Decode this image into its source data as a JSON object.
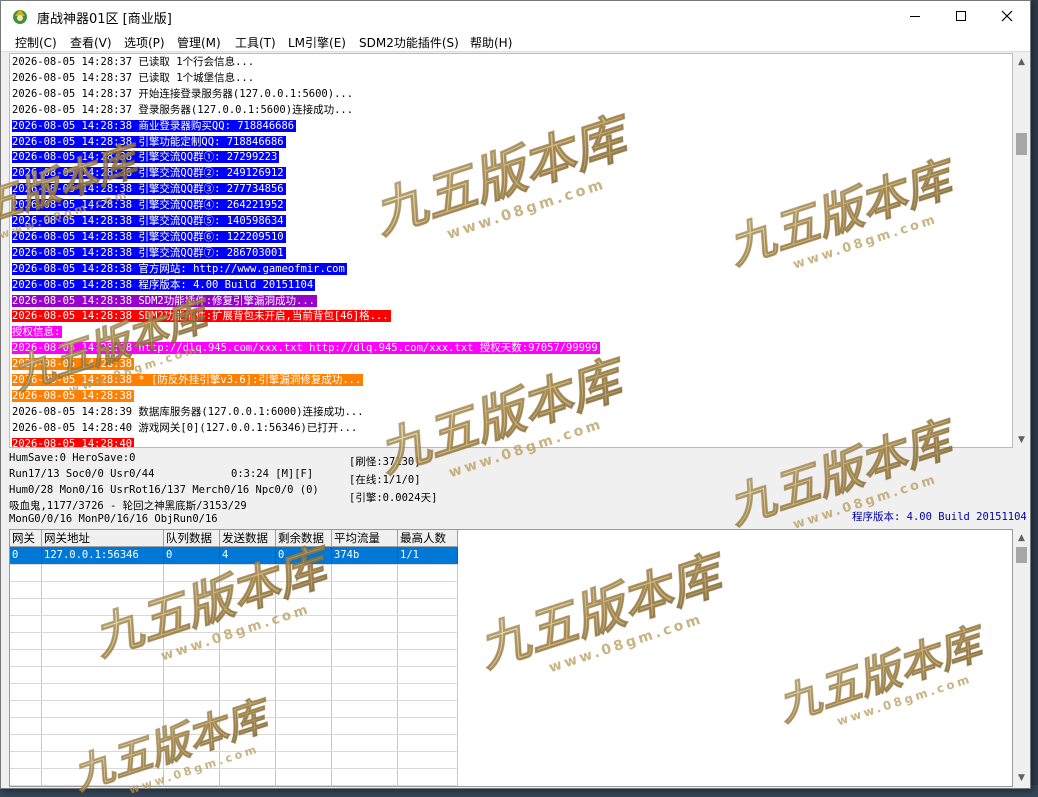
{
  "window": {
    "title": "唐战神器01区 [商业版]"
  },
  "menu": [
    "控制(C)",
    "查看(V)",
    "选项(P)",
    "管理(M)",
    "工具(T)",
    "LM引擎(E)",
    "SDM2功能插件(S)",
    "帮助(H)"
  ],
  "log": [
    {
      "text": "2026-08-05 14:28:37 已读取 1个行会信息...",
      "bg": "",
      "fg": "#000000"
    },
    {
      "text": "2026-08-05 14:28:37 已读取 1个城堡信息...",
      "bg": "",
      "fg": "#000000"
    },
    {
      "text": "2026-08-05 14:28:37 开始连接登录服务器(127.0.0.1:5600)...",
      "bg": "",
      "fg": "#000000"
    },
    {
      "text": "2026-08-05 14:28:37 登录服务器(127.0.0.1:5600)连接成功...",
      "bg": "",
      "fg": "#000000"
    },
    {
      "text": "2026-08-05 14:28:38 商业登录器购买QQ: 718846686",
      "bg": "#0000ff",
      "fg": "#ffffff"
    },
    {
      "text": "2026-08-05 14:28:38 引擎功能定制QQ: 718846686",
      "bg": "#0000ff",
      "fg": "#ffffff"
    },
    {
      "text": "2026-08-05 14:28:38 引擎交流QQ群①: 27299223",
      "bg": "#0000ff",
      "fg": "#ffffff"
    },
    {
      "text": "2026-08-05 14:28:38 引擎交流QQ群②: 249126912",
      "bg": "#0000ff",
      "fg": "#ffffff"
    },
    {
      "text": "2026-08-05 14:28:38 引擎交流QQ群③: 277734856",
      "bg": "#0000ff",
      "fg": "#ffffff"
    },
    {
      "text": "2026-08-05 14:28:38 引擎交流QQ群④: 264221952",
      "bg": "#0000ff",
      "fg": "#ffffff"
    },
    {
      "text": "2026-08-05 14:28:38 引擎交流QQ群⑤: 140598634",
      "bg": "#0000ff",
      "fg": "#ffffff"
    },
    {
      "text": "2026-08-05 14:28:38 引擎交流QQ群⑥: 122209510",
      "bg": "#0000ff",
      "fg": "#ffffff"
    },
    {
      "text": "2026-08-05 14:28:38 引擎交流QQ群⑦: 286703001",
      "bg": "#0000ff",
      "fg": "#ffffff"
    },
    {
      "text": "2026-08-05 14:28:38 官方网站: http://www.gameofmir.com",
      "bg": "#0000ff",
      "fg": "#ffffff"
    },
    {
      "text": "2026-08-05 14:28:38 程序版本: 4.00 Build 20151104",
      "bg": "#0000ff",
      "fg": "#ffffff"
    },
    {
      "text": "2026-08-05 14:28:38 SDM2功能插件:修复引擎漏洞成功...",
      "bg": "#9900cc",
      "fg": "#ffffff"
    },
    {
      "text": "2026-08-05 14:28:38 SDM2功能插件:扩展背包未开启,当前背包[46]格...",
      "bg": "#ff0000",
      "fg": "#ffffff"
    },
    {
      "text": "授权信息:",
      "bg": "#ff00ff",
      "fg": "#ffffff"
    },
    {
      "text": "2026-08-05 14:28:38 http://dlq.945.com/xxx.txt http://dlq.945.com/xxx.txt 授权天数:97057/99999",
      "bg": "#ff00ff",
      "fg": "#ffffff"
    },
    {
      "text": "2026-08-05 14:28:38",
      "bg": "#ff8000",
      "fg": "#ffffff"
    },
    {
      "text": "2026-08-05 14:28:38 * [防反外挂引擎v3.6]:引擎漏洞修复成功...",
      "bg": "#ff8000",
      "fg": "#ffffff"
    },
    {
      "text": "2026-08-05 14:28:38",
      "bg": "#ff8000",
      "fg": "#ffffff"
    },
    {
      "text": "2026-08-05 14:28:39 数据库服务器(127.0.0.1:6000)连接成功...",
      "bg": "",
      "fg": "#000000"
    },
    {
      "text": "2026-08-05 14:28:40 游戏网关[0](127.0.0.1:56346)已打开...",
      "bg": "",
      "fg": "#000000"
    },
    {
      "text": "2026-08-05 14:28:40",
      "bg": "#ff0000",
      "fg": "#ffffff"
    }
  ],
  "status": {
    "line1": "HumSave:0 HeroSave:0",
    "line2": "Run17/13 Soc0/0 Usr0/44",
    "time": "0:3:24 [M][F]",
    "line3": "Hum0/28 Mon0/16 UsrRot16/137 Merch0/16 Npc0/0 (0)",
    "line4": "吸血鬼,1177/3726 - 轮回之神黑底斯/3153/29",
    "line5": "MonG0/0/16 MonP0/16/16 ObjRun0/16",
    "refresh": "[刷怪:37130]",
    "online": "[在线:1/1/0]",
    "engine": "[引擎:0.0024天]",
    "version": "程序版本: 4.00 Build 20151104"
  },
  "grid": {
    "headers": [
      "网关",
      "网关地址",
      "队列数据",
      "发送数据",
      "剩余数据",
      "平均流量",
      "最高人数"
    ],
    "rows": [
      [
        "0",
        "127.0.0.1:56346",
        "0",
        "4",
        "0",
        "374b",
        "1/1"
      ]
    ]
  },
  "watermark": {
    "text": "九五版本库",
    "url": "www.08gm.com"
  },
  "colors": {
    "accent_blue": "#0000ff",
    "selection": "#0078d7"
  }
}
